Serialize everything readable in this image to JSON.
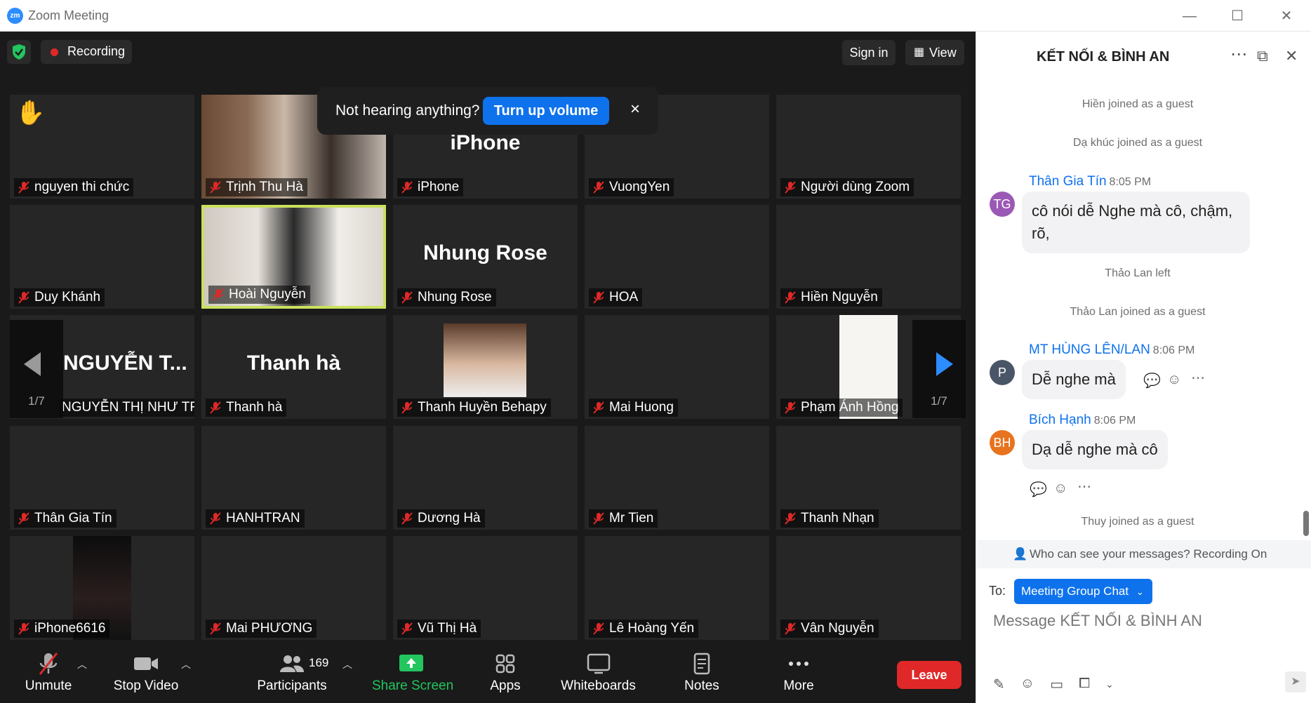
{
  "window": {
    "app_icon": "zm",
    "title": "Zoom Meeting"
  },
  "top_bar": {
    "recording_label": "Recording",
    "sign_in_label": "Sign in",
    "view_label": "View"
  },
  "toast": {
    "message": "Not hearing anything?",
    "button": "Turn up volume",
    "close": "×"
  },
  "grid": {
    "page_left": "1/7",
    "page_right": "1/7",
    "tiles": [
      {
        "name": "nguyen thi chức",
        "big": ""
      },
      {
        "name": "Trịnh Thu Hà",
        "big": ""
      },
      {
        "name": "iPhone",
        "big": "iPhone"
      },
      {
        "name": "VuongYen",
        "big": ""
      },
      {
        "name": "Người dùng Zoom",
        "big": ""
      },
      {
        "name": "Duy Khánh",
        "big": ""
      },
      {
        "name": "Hoài Nguyễn",
        "big": ""
      },
      {
        "name": "Nhung Rose",
        "big": "Nhung Rose"
      },
      {
        "name": "HOA",
        "big": ""
      },
      {
        "name": "Hiền Nguyễn",
        "big": ""
      },
      {
        "name": "NGUYỄN THỊ NHƯ TR...",
        "big": "NGUYỄN T..."
      },
      {
        "name": "Thanh hà",
        "big": "Thanh hà"
      },
      {
        "name": "Thanh Huyền Behapy",
        "big": ""
      },
      {
        "name": "Mai Huong",
        "big": ""
      },
      {
        "name": "Phạm Ánh Hồng",
        "big": ""
      },
      {
        "name": "Thân Gia Tín",
        "big": ""
      },
      {
        "name": "HANHTRAN",
        "big": ""
      },
      {
        "name": "Dương Hà",
        "big": ""
      },
      {
        "name": "Mr Tien",
        "big": ""
      },
      {
        "name": "Thanh Nhạn",
        "big": ""
      },
      {
        "name": "iPhone6616",
        "big": ""
      },
      {
        "name": "Mai PHƯƠNG",
        "big": ""
      },
      {
        "name": "Vũ Thị Hà",
        "big": ""
      },
      {
        "name": "Lê Hoàng Yến",
        "big": ""
      },
      {
        "name": "Vân Nguyễn",
        "big": ""
      }
    ]
  },
  "toolbar": {
    "unmute": "Unmute",
    "stop_video": "Stop Video",
    "participants": "Participants",
    "participant_count": "169",
    "share_screen": "Share Screen",
    "apps": "Apps",
    "whiteboards": "Whiteboards",
    "notes": "Notes",
    "more": "More",
    "leave": "Leave"
  },
  "chat": {
    "title": "KẾT NỐI & BÌNH AN",
    "system": [
      "Hiền joined as a guest",
      "Dạ khúc joined as a guest",
      "Thảo Lan  left",
      "Thảo Lan  joined as a guest",
      "Thuy joined as a guest"
    ],
    "messages": [
      {
        "initials": "TG",
        "sender": "Thân Gia Tín",
        "time": "8:05 PM",
        "text": "cô nói dễ Nghe mà cô, chậm, rõ,",
        "color": "#9b59b6"
      },
      {
        "initials": "P",
        "sender": "MT HÙNG LÊN/LAN",
        "time": "8:06 PM",
        "text": "Dễ nghe mà",
        "color": "#4a5568"
      },
      {
        "initials": "BH",
        "sender": "Bích Hạnh",
        "time": "8:06 PM",
        "text": "Dạ dễ nghe mà cô",
        "color": "#e8731f"
      }
    ],
    "notice": "Who can see your messages? Recording On",
    "to_label": "To:",
    "to_value": "Meeting Group Chat",
    "placeholder": "Message  KẾT NỐI & BÌNH AN"
  }
}
